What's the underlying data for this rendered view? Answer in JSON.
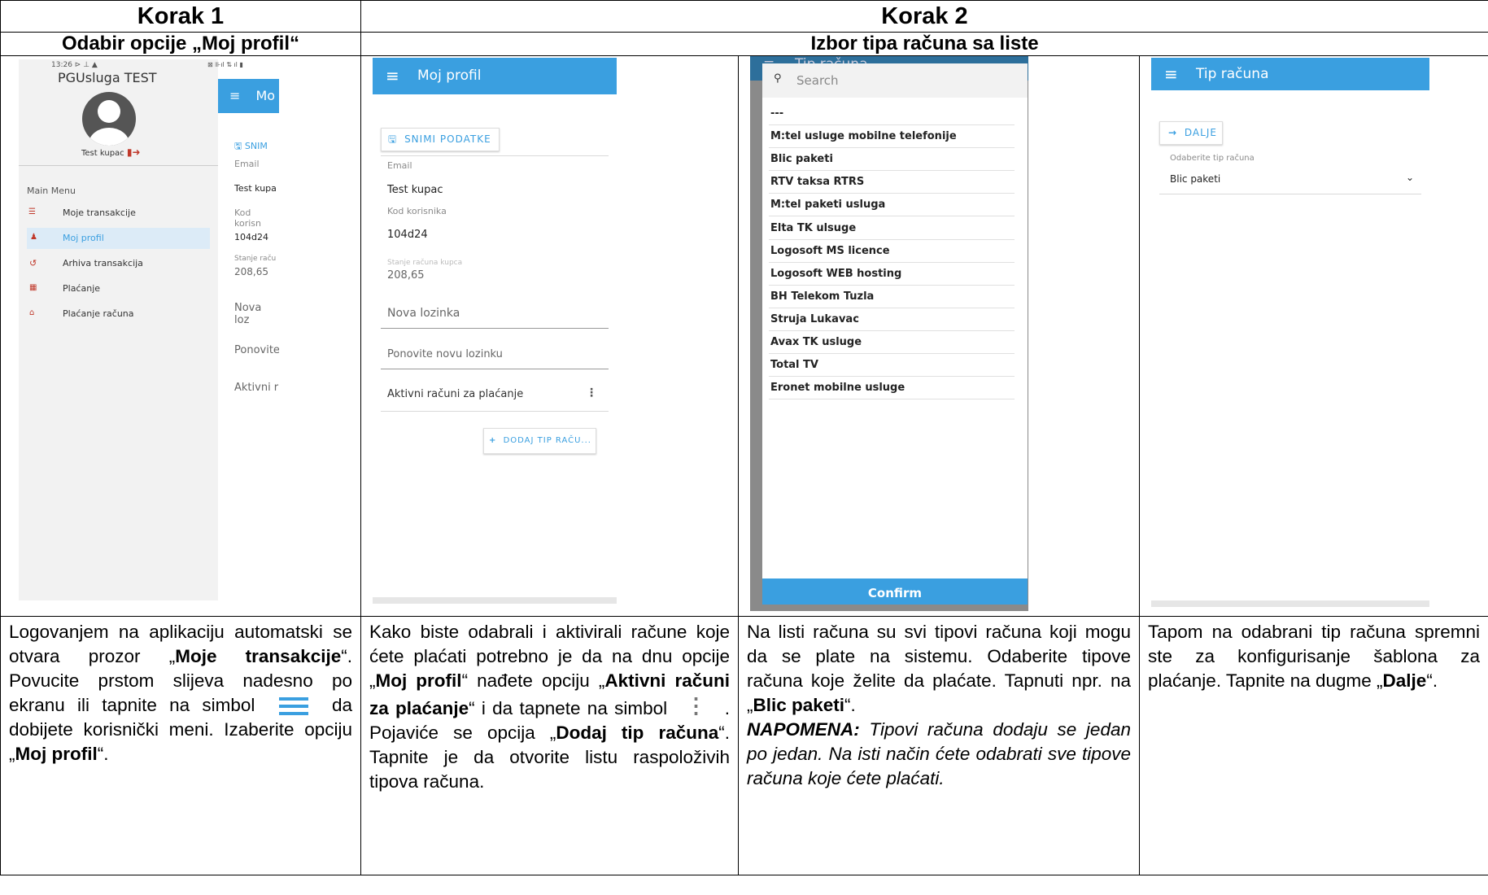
{
  "headers": {
    "step1": "Korak 1",
    "step2": "Korak 2"
  },
  "subheaders": {
    "step1": "Odabir opcije „Moj profil“",
    "step2": "Izbor tipa računa sa liste"
  },
  "screen1": {
    "status": "13:26 ⊳ ⊥ ▲",
    "status_right": "⊠ ⊪ıl ⇅ ıl ▮",
    "app_title": "PGUsluga TEST",
    "user_name": "Test kupac",
    "menu_heading": "Main Menu",
    "menu_items": [
      "Moje transakcije",
      "Moj profil",
      "Arhiva transakcija",
      "Plaćanje",
      "Plaćanje računa"
    ],
    "behind": {
      "bar_title": "Mo",
      "save": "SNIM",
      "email_label": "Email",
      "email_value": "Test kupa",
      "code_label": "Kod korisn",
      "code_value": "104d24",
      "balance_label": "Stanje raču",
      "balance_value": "208,65",
      "new_pass": "Nova loz",
      "repeat_pass": "Ponovite",
      "active": "Aktivni r"
    }
  },
  "screen2": {
    "bar_title": "Moj profil",
    "save_label": "SNIMI PODATKE",
    "email_label": "Email",
    "email_value": "Test kupac",
    "code_label": "Kod korisnika",
    "code_value": "104d24",
    "balance_label": "Stanje računa kupca",
    "balance_value": "208,65",
    "new_pass": "Nova lozinka",
    "repeat_pass": "Ponovite novu lozinku",
    "active_accounts": "Aktivni računi za plaćanje",
    "add_type": "DODAJ TIP RAČU..."
  },
  "screen3": {
    "behind_title": "Tip računa",
    "search_placeholder": "Search",
    "items": [
      "---",
      "M:tel usluge mobilne telefonije",
      "Blic paketi",
      "RTV taksa RTRS",
      "M:tel paketi usluga",
      "Elta TK ulsuge",
      "Logosoft MS licence",
      "Logosoft WEB hosting",
      "BH Telekom Tuzla",
      "Struja Lukavac",
      "Avax TK usluge",
      "Total TV",
      "Eronet mobilne usluge"
    ],
    "confirm": "Confirm"
  },
  "screen4": {
    "bar_title": "Tip računa",
    "next_label": "DALJE",
    "select_label": "Odaberite tip računa",
    "select_value": "Blic paketi"
  },
  "desc1": {
    "p1": "Logovanjem na aplikaciju automatski se otvara prozor „",
    "b1": "Moje transakcije",
    "p2": "“. Povucite prstom slijeva nadesno po ekranu ili tapnite na simbol",
    "p3": "da dobijete korisnički meni. Izaberite opciju „",
    "b2": "Moj profil",
    "p4": "“."
  },
  "desc2": {
    "p1": "Kako biste odabrali i aktivirali račune koje ćete plaćati potrebno je da na dnu opcije „",
    "b1": "Moj profil",
    "p2": "“ nađete opciju „",
    "b2": "Aktivni računi za plaćanje",
    "p3": "“ i da tapnete na simbol",
    "p4": ". Pojaviće se opcija „",
    "b3": "Dodaj tip računa",
    "p5": "“. Tapnite je da otvorite listu raspoloživih tipova računa."
  },
  "desc3": {
    "p1": "Na listi računa su svi tipovi računa koji mogu da se plate na sistemu. Odaberite tipove računa koje želite da plaćate. Tapnuti npr. na „",
    "b1": "Blic paketi",
    "p2": "“.",
    "note_label": "NAPOMENA:",
    "note_text": "Tipovi računa dodaju se jedan po jedan. Na isti način ćete odabrati sve tipove računa koje ćete plaćati."
  },
  "desc4": {
    "p1": "Tapom na odabrani tip računa spremni ste za konfigurisanje šablona za plaćanje. Tapnite na dugme „",
    "b1": "Dalje",
    "p2": "“."
  },
  "colors": {
    "accent": "#3a9fe0",
    "drawer_selected": "#dcebf7",
    "menu_icon": "#c0392b"
  }
}
